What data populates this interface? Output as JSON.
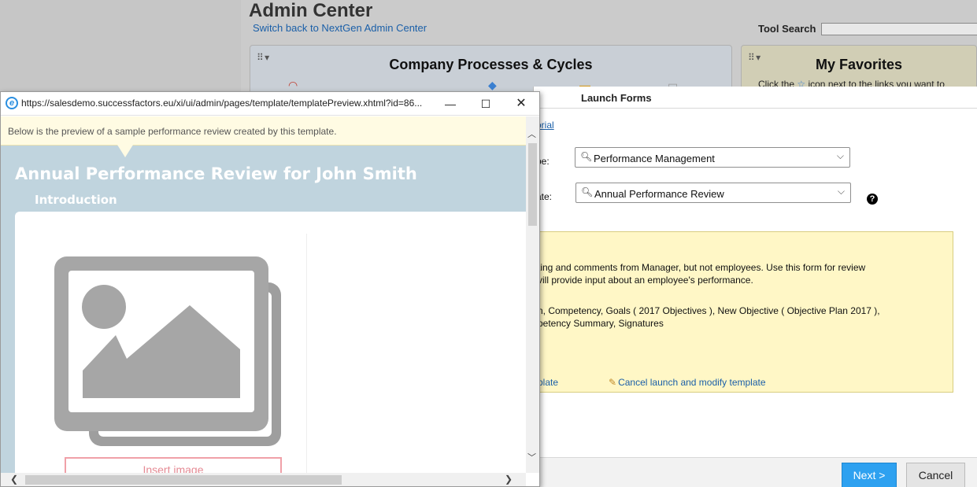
{
  "admin": {
    "title": "Admin Center",
    "switch_link": "Switch back to NextGen Admin Center",
    "tool_search_label": "Tool Search"
  },
  "portlets": {
    "processes_title": "Company Processes & Cycles",
    "favorites_title": "My Favorites",
    "favorites_text_before": "Click the",
    "favorites_text_after": "icon next to the links you want to"
  },
  "launch": {
    "title": "Launch Forms",
    "tutorial_link": "orial",
    "type_label": "pe:",
    "template_label": "ate:",
    "type_value": "Performance Management",
    "template_value": "Annual Performance Review",
    "info_line1": "ting and comments from Manager, but not employees. Use this form for review",
    "info_line2": "vill provide input about an employee's performance.",
    "info_line3": "n, Competency, Goals ( 2017 Objectives ), New Objective ( Objective Plan 2017 ),",
    "info_line4": "petency Summary, Signatures",
    "link_template": "plate",
    "link_cancel": "Cancel launch and modify template",
    "next_button": "Next >",
    "cancel_button": "Cancel",
    "help_glyph": "?"
  },
  "popup": {
    "url": "https://salesdemo.successfactors.eu/xi/ui/admin/pages/template/templatePreview.xhtml?id=86...",
    "notice": "Below is the preview of a sample performance review created by this template.",
    "review_title": "Annual Performance Review for John Smith",
    "section_title": "Introduction",
    "insert_image": "Insert image",
    "icons": {
      "browser": "ie-icon",
      "minimize": "minimize-icon",
      "maximize": "maximize-icon",
      "close": "close-icon"
    }
  },
  "colors": {
    "link": "#1a5fa8",
    "next_button": "#2ea1f0",
    "info_box": "#fff7c6",
    "preview_bg": "#c0d4de",
    "insert_border": "#f0a0a8"
  }
}
